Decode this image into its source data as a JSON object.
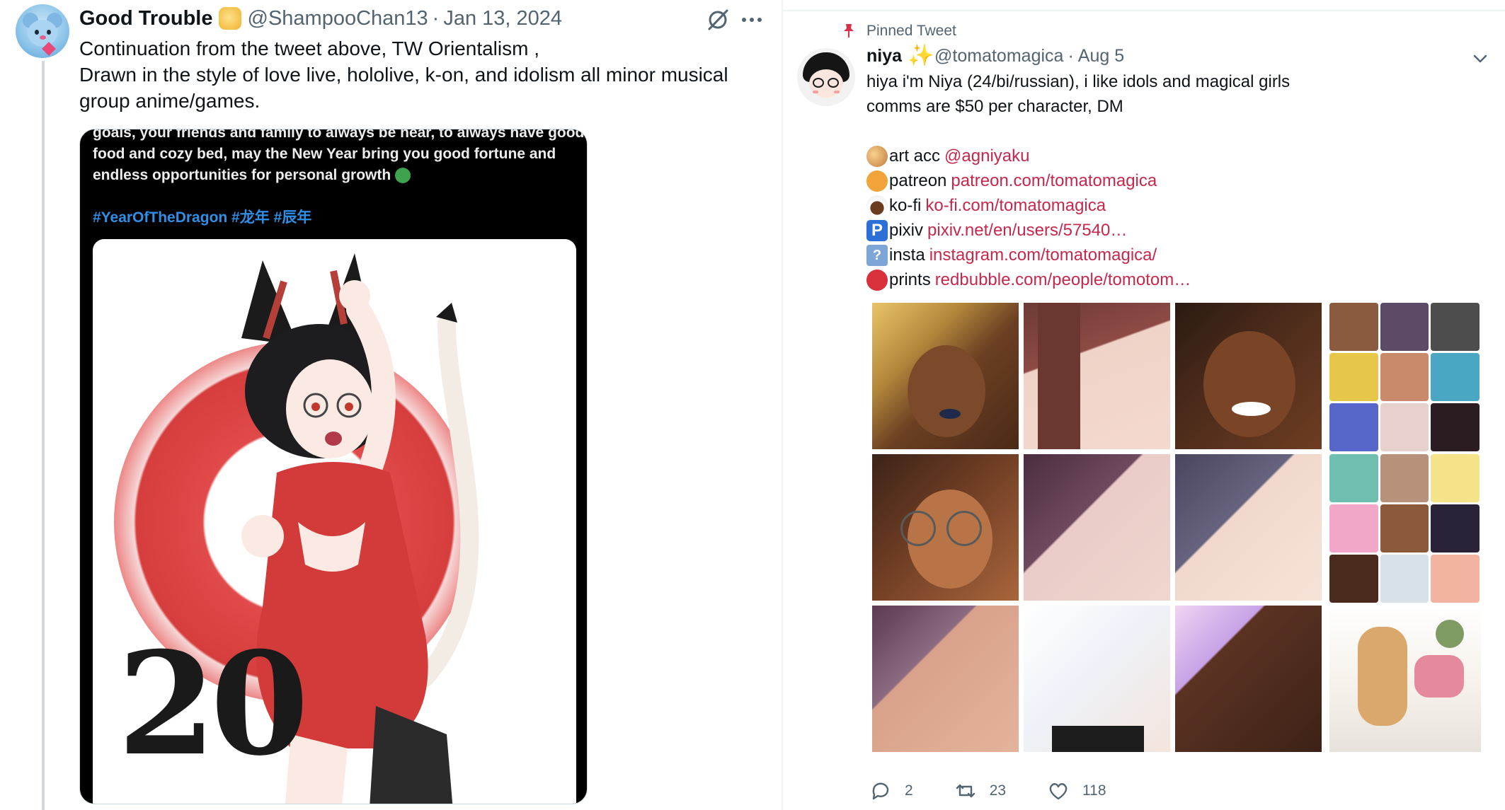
{
  "left_tweet": {
    "display_name": "Good Trouble",
    "handle": "@ShampooChan13",
    "separator": "·",
    "date": "Jan 13, 2024",
    "text_lines": [
      "Continuation from the tweet above, TW Orientalism ,",
      "Drawn in the style of love live, hololive, k-on, and idolism all minor musical",
      "group anime/games."
    ],
    "media": {
      "caption_lines": [
        "goals, your friends and family to always be near, to always have good",
        "food and cozy bed, may the New Year bring you good fortune and",
        "endless opportunities for personal growth"
      ],
      "hashtags": "#YearOfTheDragon #龙年 #辰年",
      "art_year": "20"
    }
  },
  "right_tweet": {
    "pinned_label": "Pinned Tweet",
    "display_name": "niya",
    "handle": "@tomatomagica",
    "separator": "·",
    "date": "Aug 5",
    "bio_lines": [
      "hiya i'm Niya (24/bi/russian), i like idols and magical girls",
      "comms are $50 per character, DM"
    ],
    "links": [
      {
        "icon": "palette-icon",
        "label": "art acc",
        "url": "@agniyaku"
      },
      {
        "icon": "orange-circle-icon",
        "label": "patreon",
        "url": "patreon.com/tomatomagica"
      },
      {
        "icon": "coffee-icon",
        "label": "ko-fi",
        "url": "ko-fi.com/tomatomagica"
      },
      {
        "icon": "parking-icon",
        "label": "pixiv",
        "url": "pixiv.net/en/users/57540…"
      },
      {
        "icon": "question-icon",
        "label": "insta",
        "url": "instagram.com/tomatomagica/"
      },
      {
        "icon": "red-circle-icon",
        "label": "prints",
        "url": "redbubble.com/people/tomotom…"
      }
    ],
    "actions": {
      "replies": "2",
      "retweets": "23",
      "likes": "118"
    }
  },
  "colors": {
    "link": "#c6284c",
    "secondary_text": "#536471",
    "hashtag": "#2f8fe6"
  }
}
